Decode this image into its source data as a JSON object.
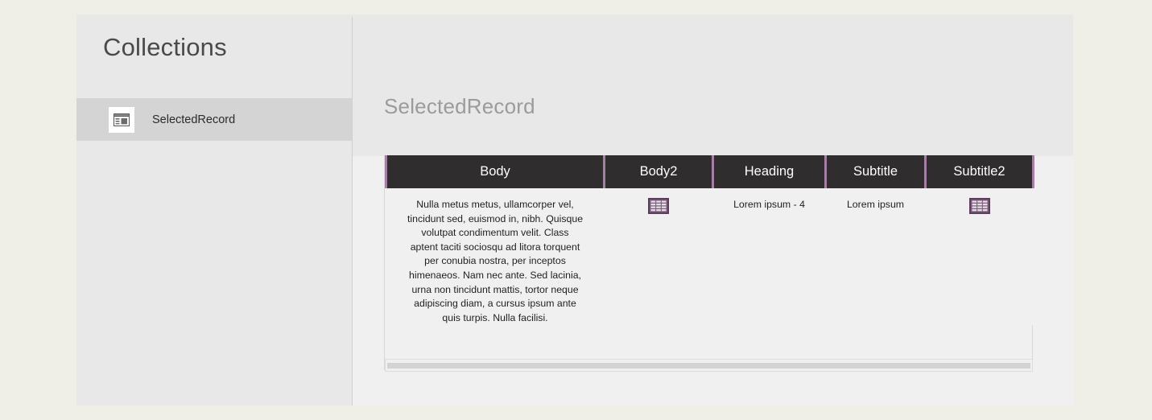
{
  "sidebar": {
    "title": "Collections",
    "items": [
      {
        "label": "SelectedRecord",
        "icon": "record-form-icon",
        "selected": true
      }
    ]
  },
  "main": {
    "title": "SelectedRecord",
    "table": {
      "columns": [
        "Body",
        "Body2",
        "Heading",
        "Subtitle",
        "Subtitle2"
      ],
      "rows": [
        {
          "Body": "Nulla metus metus, ullamcorper vel, tincidunt sed, euismod in, nibh. Quisque volutpat condimentum velit. Class aptent taciti sociosqu ad litora torquent per conubia nostra, per inceptos himenaeos. Nam nec ante. Sed lacinia, urna non tincidunt mattis, tortor neque adipiscing diam, a cursus ipsum ante quis turpis. Nulla facilisi.",
          "Body2": "table-grid-icon",
          "Heading": "Lorem ipsum - 4",
          "Subtitle": "Lorem ipsum",
          "Subtitle2": "table-grid-icon"
        }
      ]
    },
    "scrollbar": {
      "orientation": "horizontal"
    }
  },
  "colors": {
    "page_background": "#efefe8",
    "panel_background": "#e8e8e8",
    "content_background": "#f0f0f0",
    "table_header_background": "#2f2d2e",
    "accent_purple": "#a57fa5",
    "sidebar_selected": "#d4d4d4",
    "title_gray": "#9b9b9b"
  }
}
